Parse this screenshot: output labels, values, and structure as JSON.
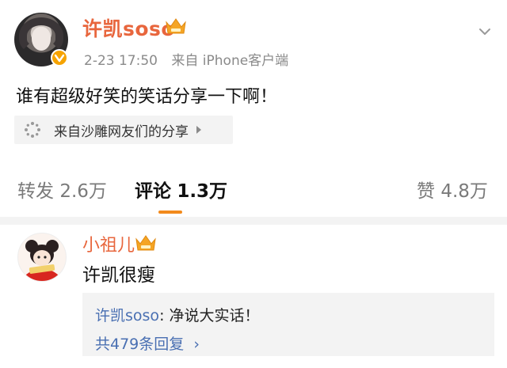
{
  "post": {
    "author": "许凯soso",
    "time": "2-23 17:50",
    "source": "来自 iPhone客户端",
    "text": "谁有超级好笑的笑话分享一下啊！",
    "share_source": "来自沙雕网友们的分享",
    "accent": "#e8663d",
    "badge_color": "#f6a300"
  },
  "tabs": [
    {
      "label": "转发",
      "count": "2.6万"
    },
    {
      "label": "评论",
      "count": "1.3万",
      "active": true
    },
    {
      "label": "赞",
      "count": "4.8万"
    }
  ],
  "comment": {
    "author": "小祖儿",
    "text": "许凯很瘦",
    "reply": {
      "author": "许凯soso",
      "sep": ": ",
      "text": "净说大实话！",
      "more": "共479条回复",
      "more_arrow": "›"
    },
    "link_color": "#496fb2"
  },
  "icons": [
    "chevron-down-icon",
    "vip-crown-icon",
    "verified-badge-icon",
    "loading-spinner-icon",
    "triangle-right-icon",
    "avatar"
  ]
}
